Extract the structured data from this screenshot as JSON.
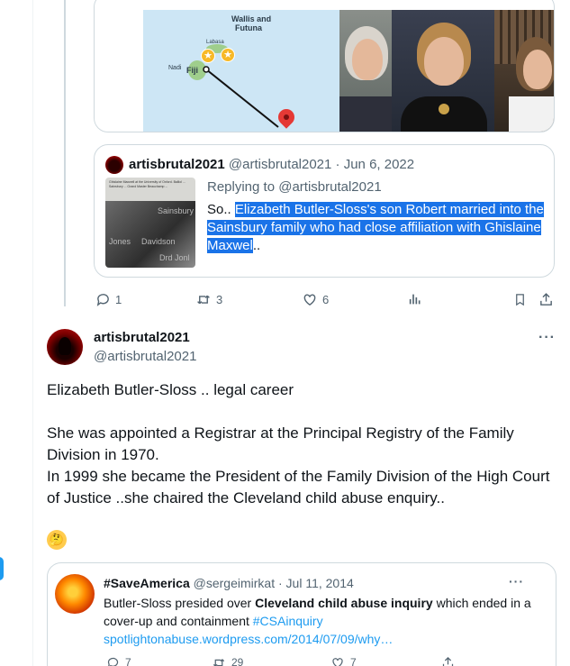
{
  "map": {
    "label_wallis": "Wallis and",
    "label_futuna": "Futuna",
    "label_labasa": "Labasa",
    "label_nadi": "Nadi",
    "label_fiji": "Fiji"
  },
  "quote1": {
    "name": "artisbrutal2021",
    "handle": "@artisbrutal2021",
    "sep": "·",
    "date": "Jun 6, 2022",
    "replying": "Replying to @artisbrutal2021",
    "body_prefix": "So.. ",
    "body_highlight": "Elizabeth Butler-Sloss's son Robert married into the Sainsbury family who had close affiliation with Ghislaine Maxwel",
    "body_suffix": "..",
    "thumb_text": "Ghislaine Maxwell at the University of Oxford. Balliol ... Sainsbury ... Grand Master Beauchamp ...",
    "thumb_words": [
      "Sainsbury",
      "Jones",
      "Davidson",
      "Drd Jonl"
    ]
  },
  "actions1": {
    "reply_count": "1",
    "retweet_count": "3",
    "like_count": "6"
  },
  "tweet": {
    "name": "artisbrutal2021",
    "handle": "@artisbrutal2021",
    "more": "···",
    "text": "Elizabeth Butler-Sloss .. legal career\n\n She was appointed a Registrar at the Principal Registry of the Family Division in 1970.\nIn 1999 she became the President of the Family Division of the High Court of Justice ..she chaired the Cleveland child abuse enquiry..",
    "emoji": "🤔"
  },
  "quote2": {
    "name": "#SaveAmerica",
    "handle": "@sergeimirkat",
    "sep": "·",
    "date": "Jul 11, 2014",
    "more": "···",
    "body_a": "Butler-Sloss presided over ",
    "body_bold": "Cleveland child abuse inquiry",
    "body_b": " which ended in a cover-up and containment ",
    "hashtag": "#CSAinquiry",
    "link": "spotlightonabuse.wordpress.com/2014/07/09/why…",
    "reply_count": "7",
    "retweet_count": "29",
    "like_count": "7"
  },
  "colors": {
    "accent": "#1d9bf0",
    "highlight": "#1a73e8",
    "muted": "#536471",
    "border": "#cfd9de"
  },
  "icons": [
    "reply-icon",
    "retweet-icon",
    "like-icon",
    "views-icon",
    "bookmark-icon",
    "share-icon",
    "more-icon"
  ]
}
